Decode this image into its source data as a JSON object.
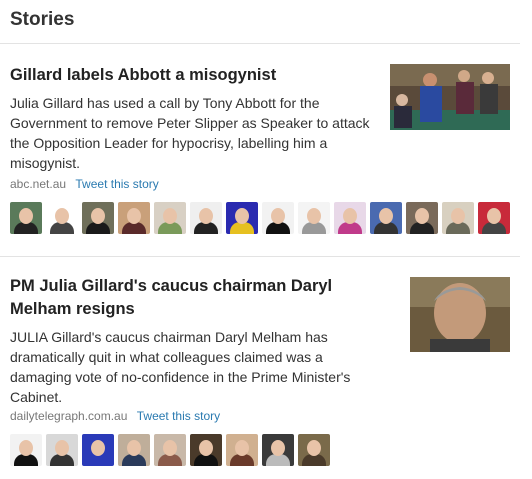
{
  "header": {
    "title": "Stories"
  },
  "stories": [
    {
      "title": "Gillard labels Abbott a misogynist",
      "summary": "Julia Gillard has used a call by Tony Abbott for the Government to remove Peter Slipper as Speaker to attack the Opposition Leader for hypocrisy, labelling him a misogynist.",
      "source": "abc.net.au",
      "tweet_label": "Tweet this story",
      "avatars": [
        {
          "bg": "#5a7a5a",
          "body": "#222"
        },
        {
          "bg": "#ffffff",
          "body": "#444"
        },
        {
          "bg": "#6f6f5a",
          "body": "#1a1a1a"
        },
        {
          "bg": "#c9a07a",
          "body": "#5a2a2a"
        },
        {
          "bg": "#d8d0c4",
          "body": "#7a9a5a"
        },
        {
          "bg": "#efefef",
          "body": "#222"
        },
        {
          "bg": "#2a2ab0",
          "body": "#e6c020"
        },
        {
          "bg": "#f2f2f2",
          "body": "#111"
        },
        {
          "bg": "#f4f4f4",
          "body": "#999"
        },
        {
          "bg": "#e8d8e8",
          "body": "#c03a8a"
        },
        {
          "bg": "#4a6ab0",
          "body": "#333"
        },
        {
          "bg": "#7a6a5a",
          "body": "#222"
        },
        {
          "bg": "#d8d0c0",
          "body": "#6a6a5a"
        },
        {
          "bg": "#c82a3a",
          "body": "#444"
        }
      ]
    },
    {
      "title": "PM Julia Gillard's caucus chairman Daryl Melham resigns",
      "summary": "JULIA Gillard's caucus chairman Daryl Melham has dramatically quit in what colleagues claimed was a damaging vote of no-confidence in the Prime Minister's Cabinet.",
      "source": "dailytelegraph.com.au",
      "tweet_label": "Tweet this story",
      "avatars": [
        {
          "bg": "#f2f2f2",
          "body": "#111"
        },
        {
          "bg": "#d8d8d8",
          "body": "#333"
        },
        {
          "bg": "#2a3ab8",
          "body": "#2a3ab8"
        },
        {
          "bg": "#bfae9a",
          "body": "#2a3a5a"
        },
        {
          "bg": "#c8b8a8",
          "body": "#8a5a4a"
        },
        {
          "bg": "#4a3a2a",
          "body": "#111"
        },
        {
          "bg": "#d0b090",
          "body": "#6a3a2a"
        },
        {
          "bg": "#3a3a3a",
          "body": "#bbb"
        },
        {
          "bg": "#7a6a4a",
          "body": "#4a3a2a"
        }
      ]
    }
  ]
}
